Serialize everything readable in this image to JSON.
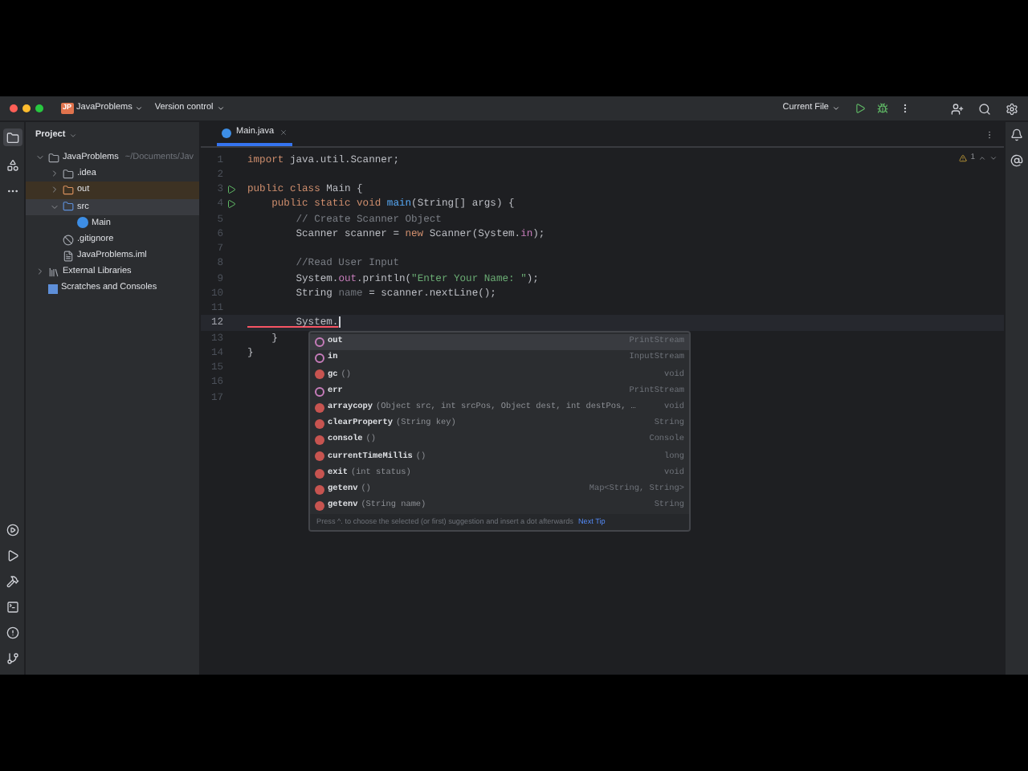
{
  "title_bar": {
    "project_badge": "JP",
    "project": "JavaProblems",
    "vcs": "Version control",
    "run_config": "Current File"
  },
  "project_panel": {
    "title": "Project",
    "tree": [
      {
        "label": "JavaProblems",
        "note": "~/Documents/Jav",
        "kind": "module",
        "expanded": true,
        "selected": false,
        "children": [
          {
            "label": ".idea",
            "kind": "folder",
            "expanded": false,
            "selected": false
          },
          {
            "label": "out",
            "kind": "excluded",
            "expanded": false,
            "selected": false
          },
          {
            "label": "src",
            "kind": "source",
            "expanded": true,
            "selected": true,
            "children": [
              {
                "label": "Main",
                "kind": "class",
                "selected": false
              }
            ]
          },
          {
            "label": ".gitignore",
            "kind": "ignore",
            "selected": false
          },
          {
            "label": "JavaProblems.iml",
            "kind": "file",
            "selected": false
          }
        ]
      },
      {
        "label": "External Libraries",
        "kind": "library",
        "expanded": false,
        "selected": false
      },
      {
        "label": "Scratches and Consoles",
        "kind": "scratch",
        "selected": false
      }
    ]
  },
  "editor": {
    "tabs": [
      {
        "label": "Main.java",
        "selected": true
      }
    ],
    "warnings": "1",
    "lines": [
      {
        "number": "1",
        "run": false,
        "current": false,
        "tokens": [
          {
            "kind": "kw",
            "text": "import"
          },
          {
            "kind": "plain",
            "text": " java.util.Scanner;"
          }
        ]
      },
      {
        "number": "2",
        "run": false,
        "current": false
      },
      {
        "number": "3",
        "run": true,
        "current": false,
        "tokens": [
          {
            "kind": "kw",
            "text": "public class"
          },
          {
            "kind": "plain",
            "text": " Main {"
          }
        ]
      },
      {
        "number": "4",
        "run": true,
        "current": false,
        "tokens": [
          {
            "kind": "kw",
            "text": "    public static void"
          },
          {
            "kind": "method",
            "text": " main"
          },
          {
            "kind": "plain",
            "text": "(String[] args) {"
          }
        ]
      },
      {
        "number": "5",
        "run": false,
        "current": false,
        "tokens": [
          {
            "kind": "comment",
            "text": "        // Create Scanner Object"
          }
        ]
      },
      {
        "number": "6",
        "run": false,
        "current": false,
        "tokens": [
          {
            "kind": "plain",
            "text": "        Scanner scanner = "
          },
          {
            "kind": "kw",
            "text": "new"
          },
          {
            "kind": "plain",
            "text": " Scanner(System."
          },
          {
            "kind": "field",
            "text": "in"
          },
          {
            "kind": "plain",
            "text": ");"
          }
        ]
      },
      {
        "number": "7",
        "run": false,
        "current": false
      },
      {
        "number": "8",
        "run": false,
        "current": false,
        "tokens": [
          {
            "kind": "comment",
            "text": "        //Read User Input"
          }
        ]
      },
      {
        "number": "9",
        "run": false,
        "current": false,
        "tokens": [
          {
            "kind": "plain",
            "text": "        System."
          },
          {
            "kind": "field",
            "text": "out"
          },
          {
            "kind": "plain",
            "text": ".println("
          },
          {
            "kind": "string",
            "text": "\"Enter Your Name: \""
          },
          {
            "kind": "plain",
            "text": ");"
          }
        ]
      },
      {
        "number": "10",
        "run": false,
        "current": false,
        "tokens": [
          {
            "kind": "plain",
            "text": "        String "
          },
          {
            "kind": "unused",
            "text": "name"
          },
          {
            "kind": "plain",
            "text": " = scanner.nextLine();"
          }
        ]
      },
      {
        "number": "11",
        "run": false,
        "current": false
      },
      {
        "number": "12",
        "run": false,
        "current": true,
        "tokens": [
          {
            "kind": "error",
            "text": "        System."
          }
        ]
      },
      {
        "number": "13",
        "run": false,
        "current": false,
        "tokens": [
          {
            "kind": "plain",
            "text": "    }"
          }
        ]
      },
      {
        "number": "14",
        "run": false,
        "current": false,
        "tokens": [
          {
            "kind": "plain",
            "text": "}"
          }
        ]
      },
      {
        "number": "15",
        "run": false,
        "current": false
      },
      {
        "number": "16",
        "run": false,
        "current": false
      },
      {
        "number": "17",
        "run": false,
        "current": false
      }
    ]
  },
  "completion": {
    "items": [
      {
        "kind": "field",
        "name": "out",
        "type": "PrintStream",
        "selected": true
      },
      {
        "kind": "field",
        "name": "in",
        "type": "InputStream",
        "selected": false
      },
      {
        "kind": "method",
        "name": "gc",
        "params": "()",
        "type": "void",
        "selected": false
      },
      {
        "kind": "field",
        "name": "err",
        "type": "PrintStream",
        "selected": false
      },
      {
        "kind": "method",
        "name": "arraycopy",
        "params": "(Object src, int srcPos, Object dest, int destPos, …",
        "type": "void",
        "selected": false
      },
      {
        "kind": "method",
        "name": "clearProperty",
        "params": "(String key)",
        "type": "String",
        "selected": false
      },
      {
        "kind": "method",
        "name": "console",
        "params": "()",
        "type": "Console",
        "selected": false
      },
      {
        "kind": "method",
        "name": "currentTimeMillis",
        "params": "()",
        "type": "long",
        "selected": false
      },
      {
        "kind": "method",
        "name": "exit",
        "params": "(int status)",
        "type": "void",
        "selected": false
      },
      {
        "kind": "method",
        "name": "getenv",
        "params": "()",
        "type": "Map<String, String>",
        "selected": false
      },
      {
        "kind": "method",
        "name": "getenv",
        "params": "(String name)",
        "type": "String",
        "selected": false
      }
    ],
    "hint": "Press ^. to choose the selected (or first) suggestion and insert a dot afterwards",
    "tip_link": "Next Tip"
  }
}
